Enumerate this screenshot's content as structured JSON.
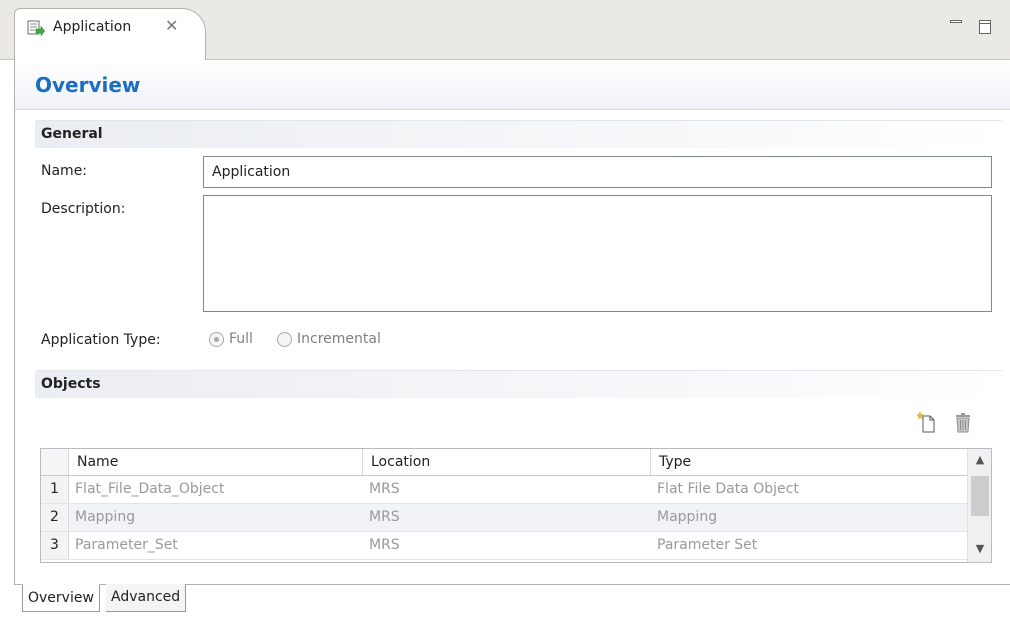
{
  "editor_tab": {
    "label": "Application",
    "close_glyph": "✕",
    "icon": "application-icon"
  },
  "window_controls": {
    "minimize": "minimize-icon",
    "maximize": "maximize-icon"
  },
  "page_title": "Overview",
  "general": {
    "title": "General",
    "name_label": "Name:",
    "name_value": "Application",
    "description_label": "Description:",
    "description_value": "",
    "app_type_label": "Application Type:",
    "options": [
      {
        "label": "Full",
        "checked": true
      },
      {
        "label": "Incremental",
        "checked": false
      }
    ]
  },
  "objects": {
    "title": "Objects",
    "toolbar": {
      "new_icon": "new-object-icon",
      "delete_icon": "delete-icon"
    },
    "columns": [
      "Name",
      "Location",
      "Type"
    ],
    "rows": [
      {
        "num": "1",
        "name": "Flat_File_Data_Object",
        "location": "MRS",
        "type": "Flat File Data Object"
      },
      {
        "num": "2",
        "name": "Mapping",
        "location": "MRS",
        "type": "Mapping"
      },
      {
        "num": "3",
        "name": "Parameter_Set",
        "location": "MRS",
        "type": "Parameter Set"
      }
    ],
    "scroll_up": "▲",
    "scroll_down": "▼"
  },
  "bottom_tabs": [
    "Overview",
    "Advanced"
  ],
  "colors": {
    "accent": "#1b6ec2",
    "disabled_text": "#9a9a9a",
    "tab_bar": "#ebe9e3"
  }
}
